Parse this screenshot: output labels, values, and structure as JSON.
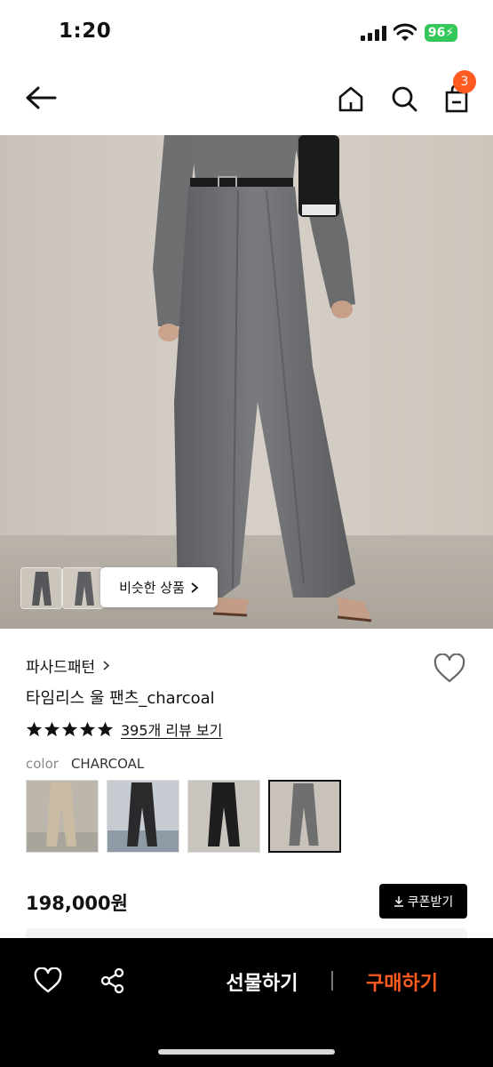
{
  "status_bar": {
    "time": "1:20",
    "battery": "96"
  },
  "nav": {
    "cart_count": "3",
    "icons": [
      "back-arrow-icon",
      "home-icon",
      "search-icon",
      "shopping-bag-icon"
    ]
  },
  "gallery": {
    "similar_products_label": "비슷한 상품"
  },
  "product": {
    "brand": "파사드패턴",
    "name": "타임리스 울 팬츠_charcoal",
    "rating_stars": 5,
    "review_link": "395개 리뷰 보기",
    "color_label": "color",
    "color_value": "CHARCOAL",
    "price": "198,000원",
    "coupon_label": "쿠폰받기",
    "color_options": [
      {
        "name": "beige",
        "color": "#c9bca2"
      },
      {
        "name": "black-1",
        "color": "#2a2a2c"
      },
      {
        "name": "black-2",
        "color": "#1e1e1e"
      },
      {
        "name": "charcoal",
        "color": "#6f6f6f",
        "selected": true
      }
    ]
  },
  "bottom_bar": {
    "gift_label": "선물하기",
    "buy_label": "구매하기",
    "accent": "#ff5a1f"
  }
}
